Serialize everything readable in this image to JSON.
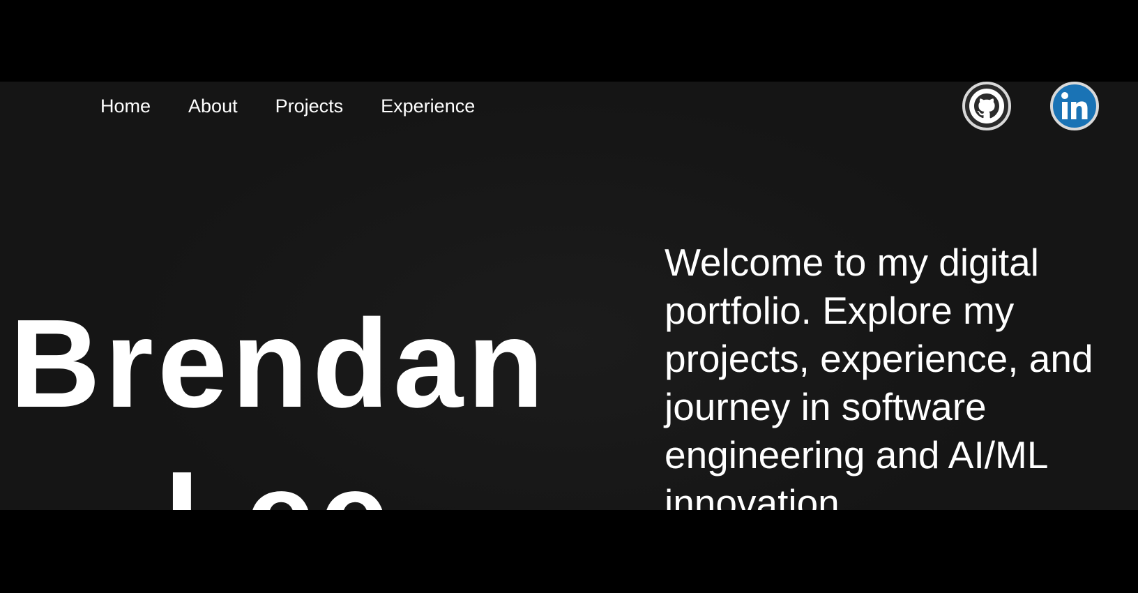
{
  "nav": {
    "items": [
      {
        "label": "Home"
      },
      {
        "label": "About"
      },
      {
        "label": "Projects"
      },
      {
        "label": "Experience"
      }
    ]
  },
  "social": {
    "github": {
      "icon": "github-icon",
      "color": "#2b2b2b"
    },
    "linkedin": {
      "icon": "linkedin-icon",
      "color": "#1a73b5"
    }
  },
  "hero": {
    "name_first": "Brendan",
    "name_last": "Lee",
    "welcome": "Welcome to my digital portfolio. Explore my projects, experience, and journey in software engineering and AI/ML innovation."
  },
  "colors": {
    "background": "#151515",
    "letterbox": "#000000",
    "text": "#ffffff"
  }
}
